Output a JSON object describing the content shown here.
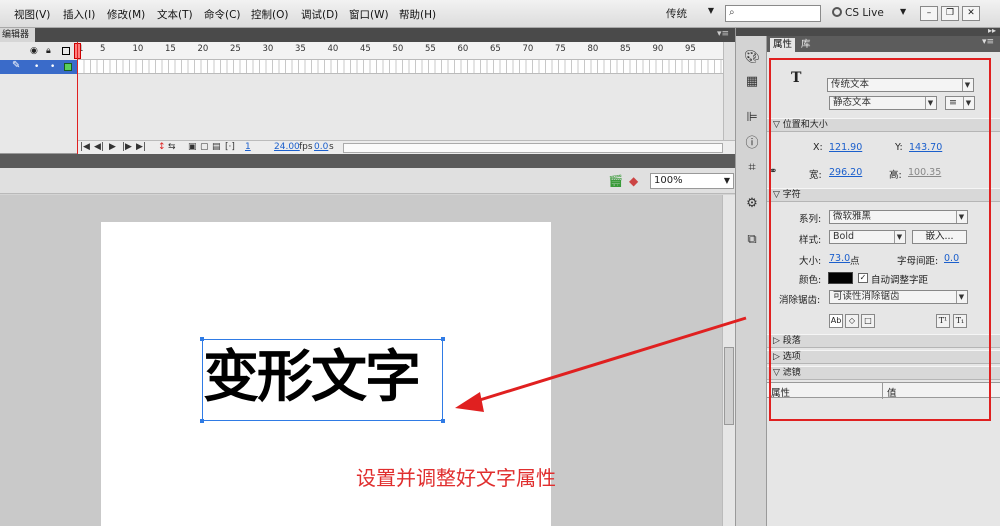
{
  "menu": {
    "items": [
      "视图(V)",
      "插入(I)",
      "修改(M)",
      "文本(T)",
      "命令(C)",
      "控制(O)",
      "调试(D)",
      "窗口(W)",
      "帮助(H)"
    ],
    "workspace": "传统",
    "cs_live": "CS Live"
  },
  "timeline": {
    "tab_label": "编辑器",
    "ruler_ticks": [
      "1",
      "5",
      "10",
      "15",
      "20",
      "25",
      "30",
      "35",
      "40",
      "45",
      "50",
      "55",
      "60",
      "65",
      "70",
      "75",
      "80",
      "85",
      "90",
      "95"
    ],
    "current_frame": "1",
    "fps": "24.00",
    "fps_unit": "fps",
    "elapsed": "0.0",
    "elapsed_unit": "s"
  },
  "stage": {
    "zoom": "100%",
    "text_content": "变形文字",
    "annotation": "设置并调整好文字属性"
  },
  "properties": {
    "tabs": [
      "属性",
      "库"
    ],
    "text_engine": "传统文本",
    "text_type": "静态文本",
    "position_size": {
      "title": "位置和大小",
      "x_label": "X:",
      "x_value": "121.90",
      "y_label": "Y:",
      "y_value": "143.70",
      "w_label": "宽:",
      "w_value": "296.20",
      "h_label": "高:",
      "h_value": "100.35"
    },
    "character": {
      "title": "字符",
      "family_label": "系列:",
      "family_value": "微软雅黑",
      "style_label": "样式:",
      "style_value": "Bold",
      "embed_button": "嵌入...",
      "size_label": "大小:",
      "size_value": "73.0",
      "size_unit": "点",
      "spacing_label": "字母间距:",
      "spacing_value": "0.0",
      "color_label": "颜色:",
      "color_value": "#000000",
      "autokern_label": "自动调整字距",
      "antialias_label": "消除锯齿:",
      "antialias_value": "可读性消除锯齿"
    },
    "sections": [
      "段落",
      "选项",
      "滤镜"
    ],
    "filter_table": {
      "col1": "属性",
      "col2": "值"
    }
  },
  "colors": {
    "highlight_red": "#e02020",
    "link_blue": "#1b5fcc",
    "selection_blue": "#2f7be5"
  }
}
